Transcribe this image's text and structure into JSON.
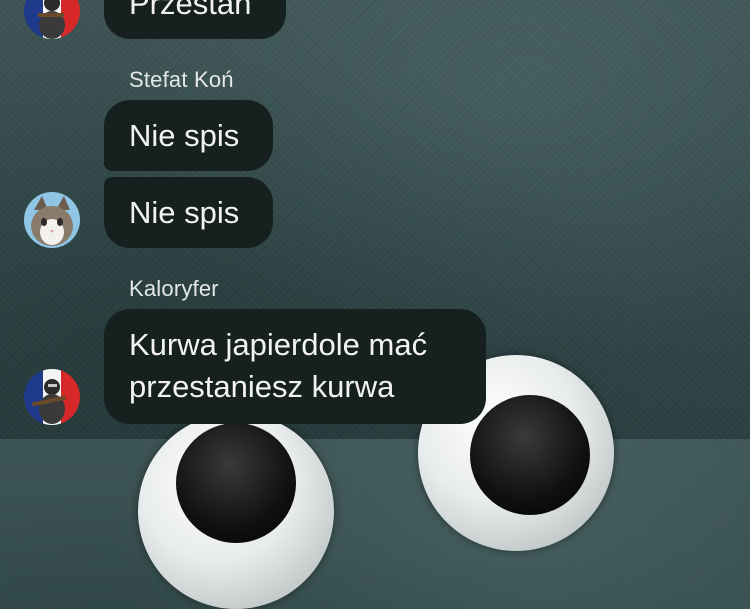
{
  "messages": [
    {
      "sender": "",
      "text": "Przestań"
    },
    {
      "sender": "Stefat Koń",
      "text": "Nie spis"
    },
    {
      "sender": "",
      "text": "Nie spis"
    },
    {
      "sender": "Kaloryfer",
      "text_line1": "Kurwa japierdole mać",
      "text_line2": "przestaniesz kurwa"
    }
  ],
  "avatars": {
    "soldier": "soldier-flag-icon",
    "cat": "cat-icon"
  },
  "colors": {
    "bubble": "#15201f",
    "background": "#344b4c",
    "text": "#f2f2f2"
  }
}
